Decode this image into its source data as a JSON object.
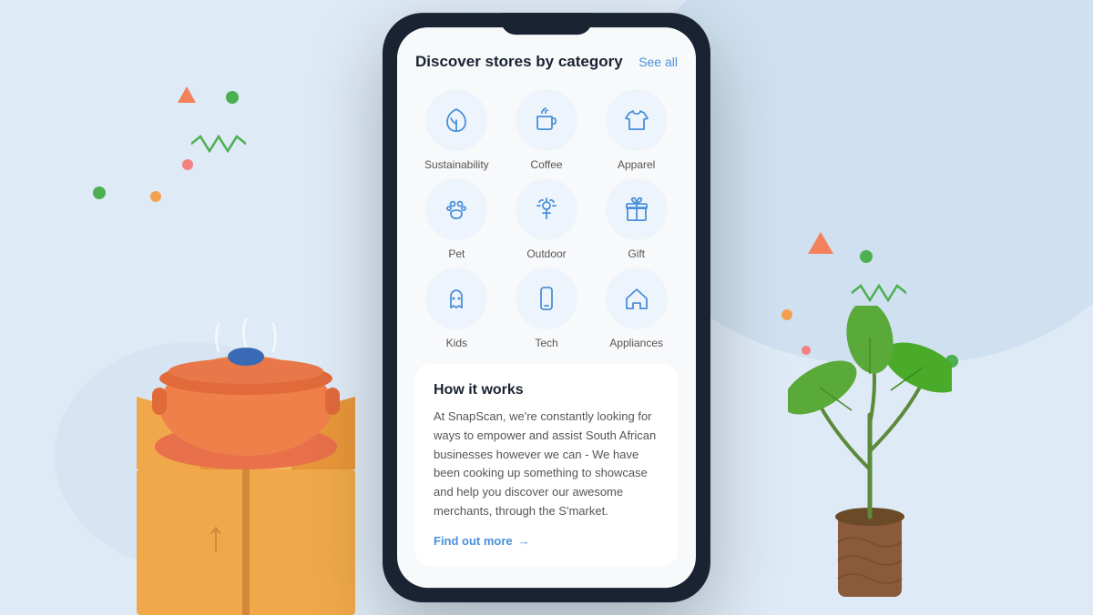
{
  "background": {
    "color": "#deeaf5"
  },
  "phone": {
    "header": {
      "title": "Discover stores by category",
      "see_all": "See all"
    },
    "categories": [
      {
        "id": "sustainability",
        "label": "Sustainability",
        "icon": "leaf"
      },
      {
        "id": "coffee",
        "label": "Coffee",
        "icon": "coffee"
      },
      {
        "id": "apparel",
        "label": "Apparel",
        "icon": "shirt"
      },
      {
        "id": "pet",
        "label": "Pet",
        "icon": "paw"
      },
      {
        "id": "outdoor",
        "label": "Outdoor",
        "icon": "outdoor"
      },
      {
        "id": "gift",
        "label": "Gift",
        "icon": "gift"
      },
      {
        "id": "kids",
        "label": "Kids",
        "icon": "ghost"
      },
      {
        "id": "tech",
        "label": "Tech",
        "icon": "phone"
      },
      {
        "id": "appliances",
        "label": "Appliances",
        "icon": "home"
      }
    ],
    "how_it_works": {
      "title": "How it works",
      "body": "At SnapScan, we're constantly looking for ways to empower and assist South African businesses however we can - We have been cooking up something to showcase and help you discover our awesome merchants, through the S'market.",
      "link_text": "Find out more",
      "link_arrow": "→"
    }
  }
}
